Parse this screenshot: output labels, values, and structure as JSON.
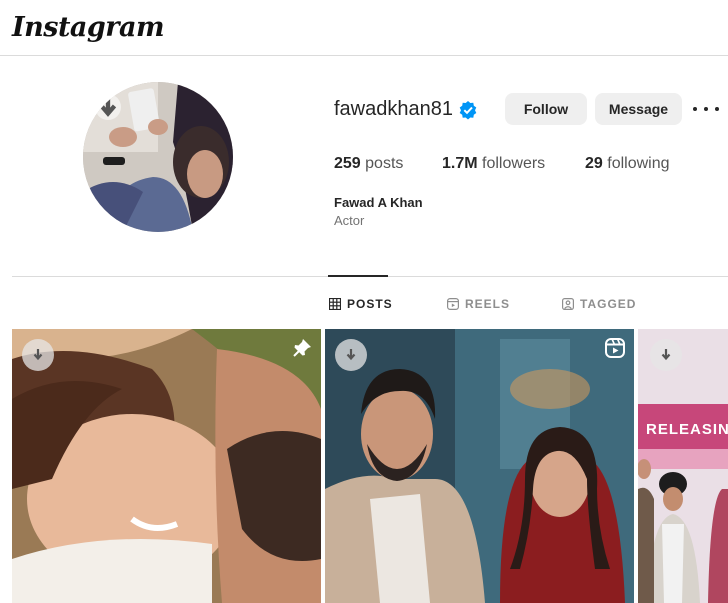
{
  "header": {
    "logo_text": "Instagram"
  },
  "profile": {
    "username": "fawadkhan81",
    "verified": true,
    "follow_label": "Follow",
    "message_label": "Message",
    "stats": {
      "posts_count": "259",
      "posts_label": "posts",
      "followers_count": "1.7M",
      "followers_label": "followers",
      "following_count": "29",
      "following_label": "following"
    },
    "full_name": "Fawad A Khan",
    "bio": "Actor"
  },
  "tabs": [
    {
      "label": "POSTS",
      "active": true,
      "icon": "grid-icon"
    },
    {
      "label": "REELS",
      "active": false,
      "icon": "reels-icon"
    },
    {
      "label": "TAGGED",
      "active": false,
      "icon": "tagged-icon"
    }
  ],
  "posts": [
    {
      "kind": "photo",
      "pinned": true,
      "icon": "pin-icon"
    },
    {
      "kind": "reel",
      "pinned": false,
      "icon": "reel-icon"
    },
    {
      "kind": "photo",
      "pinned": false,
      "overlay_text": "RELEASIN"
    }
  ],
  "colors": {
    "verified_blue": "#0095f6",
    "button_bg": "#efefef",
    "divider": "#dbdbdb",
    "text_primary": "#262626",
    "text_secondary": "#737373"
  }
}
